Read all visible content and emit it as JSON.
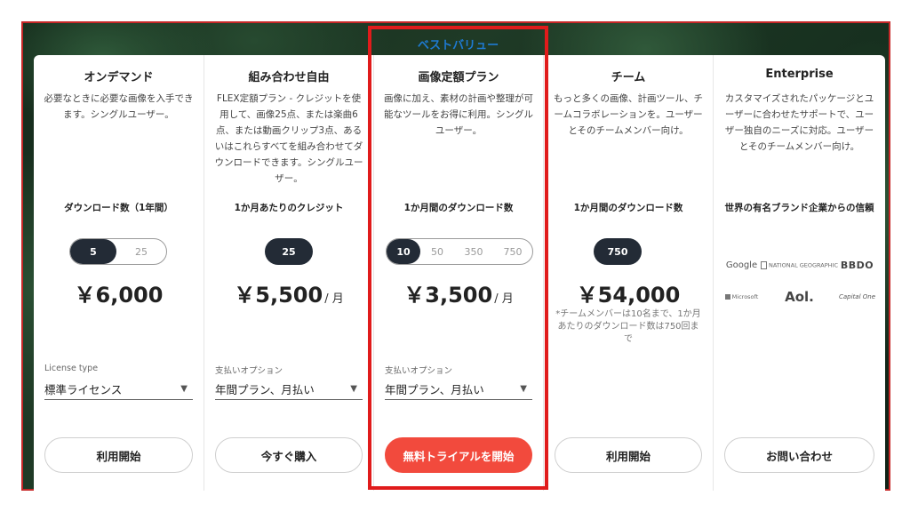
{
  "best_value_label": "ベストバリュー",
  "columns": [
    {
      "title": "オンデマンド",
      "description": "必要なときに必要な画像を入手できます。シングルユーザー。",
      "metric_label": "ダウンロード数（1年間）",
      "options": [
        "5",
        "25"
      ],
      "selected_option": "5",
      "price": "￥6,000",
      "price_unit": "",
      "select_label": "License type",
      "select_value": "標準ライセンス",
      "button_label": "利用開始"
    },
    {
      "title": "組み合わせ自由",
      "description": "FLEX定額プラン - クレジットを使用して、画像25点、または楽曲6点、または動画クリップ3点、あるいはこれらすべてを組み合わせてダウンロードできます。シングルユーザー。",
      "metric_label": "1か月あたりのクレジット",
      "options": [
        "25"
      ],
      "selected_option": "25",
      "price": "￥5,500",
      "price_unit": "/ 月",
      "select_label": "支払いオプション",
      "select_value": "年間プラン、月払い",
      "button_label": "今すぐ購入"
    },
    {
      "title": "画像定額プラン",
      "description": "画像に加え、素材の計画や整理が可能なツールをお得に利用。シングルユーザー。",
      "metric_label": "1か月間のダウンロード数",
      "options": [
        "10",
        "50",
        "350",
        "750"
      ],
      "selected_option": "10",
      "price": "￥3,500",
      "price_unit": "/ 月",
      "select_label": "支払いオプション",
      "select_value": "年間プラン、月払い",
      "button_label": "無料トライアルを開始"
    },
    {
      "title": "チーム",
      "description": "もっと多くの画像、計画ツール、チームコラボレーションを。ユーザーとそのチームメンバー向け。",
      "metric_label": "1か月間のダウンロード数",
      "options": [
        "750"
      ],
      "selected_option": "750",
      "price": "￥54,000",
      "price_unit": "",
      "note": "*チームメンバーは10名まで、1か月あたりのダウンロード数は750回まで",
      "button_label": "利用開始"
    },
    {
      "title": "Enterprise",
      "description": "カスタマイズされたパッケージとユーザーに合わせたサポートで、ユーザー独自のニーズに対応。ユーザーとそのチームメンバー向け。",
      "metric_label": "世界の有名ブランド企業からの信頼",
      "logos": [
        "Google",
        "NATIONAL GEOGRAPHIC",
        "BBDO",
        "Microsoft",
        "Aol.",
        "Capital One"
      ],
      "button_label": "お問い合わせ"
    }
  ],
  "colors": {
    "highlight_border": "#e01b1b",
    "best_value_text": "#1e7ad2",
    "primary_button": "#f24a3d",
    "toggle_active": "#232b36"
  }
}
